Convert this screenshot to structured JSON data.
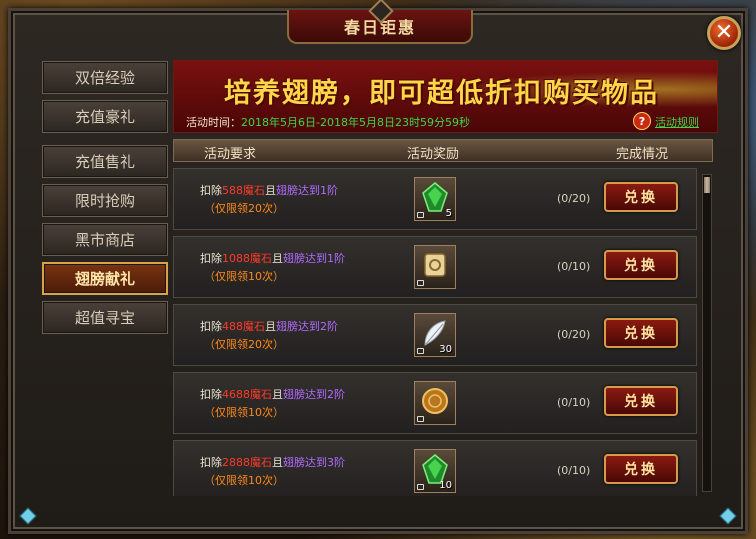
{
  "window": {
    "title": "春日钜惠",
    "close_glyph": "✕"
  },
  "sidebar": {
    "items": [
      {
        "label": "双倍经验",
        "active": false
      },
      {
        "label": "充值豪礼",
        "active": false
      },
      {
        "label": "充值售礼",
        "active": false
      },
      {
        "label": "限时抢购",
        "active": false
      },
      {
        "label": "黑市商店",
        "active": false
      },
      {
        "label": "翅膀献礼",
        "active": true
      },
      {
        "label": "超值寻宝",
        "active": false
      }
    ]
  },
  "banner": {
    "headline": "培养翅膀，即可超低折扣购买物品",
    "time_label": "活动时间：",
    "time_value": "2018年5月6日-2018年5月8日23时59分59秒",
    "help_glyph": "?",
    "rules_link": "活动规则"
  },
  "columns": {
    "requirement": "活动要求",
    "reward": "活动奖励",
    "status": "完成情况"
  },
  "rows": [
    {
      "deduct_label": "扣除",
      "amount": "588",
      "currency": "魔石",
      "conj": "且",
      "condition": "翅膀达到1阶",
      "limit": "（仅限领20次）",
      "item_icon": "green-gem-icon",
      "item_count": "5",
      "progress": "(0/20)",
      "button": "兑换"
    },
    {
      "deduct_label": "扣除",
      "amount": "1088",
      "currency": "魔石",
      "conj": "且",
      "condition": "翅膀达到1阶",
      "limit": "（仅限领10次）",
      "item_icon": "scroll-icon",
      "item_count": "",
      "progress": "(0/10)",
      "button": "兑换"
    },
    {
      "deduct_label": "扣除",
      "amount": "488",
      "currency": "魔石",
      "conj": "且",
      "condition": "翅膀达到2阶",
      "limit": "（仅限领20次）",
      "item_icon": "feather-icon",
      "item_count": "30",
      "progress": "(0/20)",
      "button": "兑换"
    },
    {
      "deduct_label": "扣除",
      "amount": "4688",
      "currency": "魔石",
      "conj": "且",
      "condition": "翅膀达到2阶",
      "limit": "（仅限领10次）",
      "item_icon": "gold-coin-icon",
      "item_count": "",
      "progress": "(0/10)",
      "button": "兑换"
    },
    {
      "deduct_label": "扣除",
      "amount": "2888",
      "currency": "魔石",
      "conj": "且",
      "condition": "翅膀达到3阶",
      "limit": "（仅限领10次）",
      "item_icon": "green-gem-icon",
      "item_count": "10",
      "progress": "(0/10)",
      "button": "兑换"
    }
  ],
  "colors": {
    "title_gold": "#f3d9a2",
    "banner_red": "#7a1010",
    "headline_yellow": "#ffd54a",
    "green_text": "#3fd64a",
    "amount_red": "#ff3a2a",
    "condition_purple": "#b06bff",
    "limit_orange": "#ff8a1a"
  }
}
